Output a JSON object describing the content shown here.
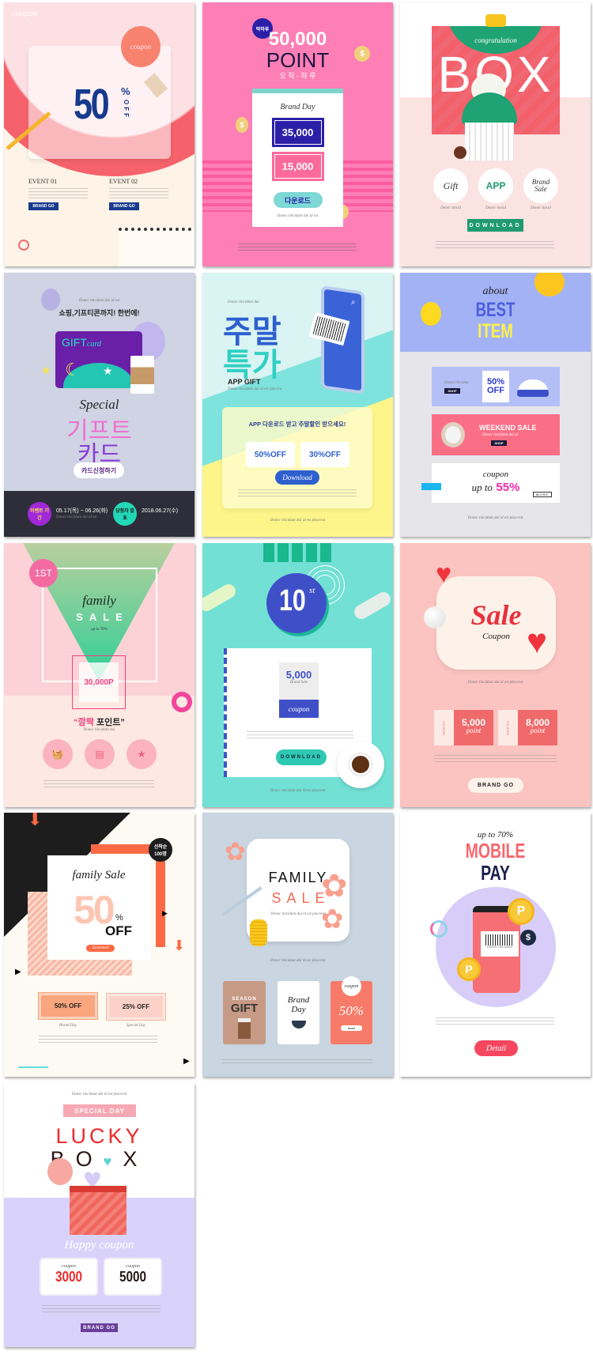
{
  "cards": [
    {
      "corner": "coupon",
      "balloon": "coupon",
      "big": "50",
      "pct": "%",
      "off": "OFF",
      "events": [
        {
          "title": "EVENT 01",
          "button": "BRAND GO"
        },
        {
          "title": "EVENT 02",
          "button": "BRAND GO"
        }
      ],
      "colors": {
        "bg": "#fdf3e6",
        "accent": "#163a8d"
      }
    },
    {
      "badge": "딱하루",
      "amount": "50,000",
      "title": "POINT",
      "sub": "오 직 - 하 루",
      "panel_title": "Brand Day",
      "coupon1": "35,000",
      "coupon2": "15,000",
      "button": "다운로드",
      "caption": "Donec tincidunt dui id est",
      "colors": {
        "bg": "#fd7fb5"
      }
    },
    {
      "ribbon": "congratulation",
      "title": "BOX",
      "circles": [
        "Gift",
        "APP",
        "Brand Sale"
      ],
      "circle_caption": "Donec tincid",
      "button": "DOWNLOAD",
      "colors": {
        "accent": "#1f9a71"
      }
    },
    {
      "caption": "Donec tincidunt dui id est",
      "headline": "쇼핑,기프티콘까지! 한번에!",
      "card_label": "GIFT",
      "card_label2": "card",
      "special": "Special",
      "title1": "기프트",
      "title2": "카드",
      "button": "카드신청하기",
      "badge1": "이벤트 기간",
      "date1": "05.17(목) ~ 06.26(화)",
      "badge2": "당첨자 발표",
      "date2": "2018.06.27(수)",
      "date_caption": "Donec tincidunt dui id est"
    },
    {
      "caption": "Donec tincidunt dui",
      "title1": "주말",
      "title2": "특가",
      "app": "APP GIFT",
      "app_caption": "Donec tincidunt dui id est placera",
      "panel_title": "APP 다운로드 받고 주말할인 받으세요!",
      "ticket1": "50%OFF",
      "ticket2": "30%OFF",
      "button": "Download",
      "footer": "Donec tincidunt dui id est placerat"
    },
    {
      "about": "about",
      "title1": "BEST",
      "title2": "ITEM",
      "banner1_caption": "Donec tincidun",
      "banner1_button": "SHOP",
      "note": "50% OFF",
      "banner2_title": "WEEKEND SALE",
      "banner2_caption": "Donec tincidunt dui id",
      "banner2_button": "SHOP",
      "coupon": "coupon",
      "upto": "up to",
      "pct": "55%",
      "more": "MORE",
      "footer": "Donec tincidunt dui id est placerat"
    },
    {
      "badge": "1ST",
      "family": "family",
      "sale": "SALE",
      "upto": "up to 70%",
      "points": "30,000P",
      "title_a": "“깜짝",
      "title_b": " 포인트”",
      "caption": "Donec tincidunt dui"
    },
    {
      "number": "10",
      "suffix": "st",
      "amount": "5,000",
      "amount_caption": "Brand Sale",
      "coupon": "coupon",
      "button": "DOWNLOAD",
      "footer": "Donec tincidunt dui id est placerat"
    },
    {
      "title": "Sale",
      "sub": "Coupon",
      "caption": "Donec tincidunt dui id est placerat",
      "coupons": [
        {
          "side": "COUPON",
          "value": "5,000",
          "unit": "point"
        },
        {
          "side": "COUPON",
          "value": "8,000",
          "unit": "point"
        }
      ],
      "button": "BRAND GO"
    },
    {
      "badge": "선착순 100명",
      "title": "family Sale",
      "big": "50",
      "pct": "%",
      "off": "OFF",
      "button": "Download",
      "box1": "50% OFF",
      "box1_caption": "Brand Day",
      "box2": "25% OFF",
      "box2_caption": "Special Day"
    },
    {
      "title1": "FAMILY",
      "title2": "SALE",
      "caption": "Donec tincidunt dui id est placerat",
      "tag1_small": "SEASON",
      "tag1_big": "GIFT",
      "tag2": "Brand Day",
      "tag3_label": "coupon",
      "tag3_value": "50%",
      "tag3_button": "more"
    },
    {
      "upto": "up to 70%",
      "title1": "MOBILE",
      "title2": "PAY",
      "barcode_caption": "Donec tincidunt",
      "coin": "P",
      "dollar": "$",
      "button": "Detail"
    },
    {
      "caption": "Donec tincidunt dui id est placerat",
      "ribbon": "SPECIAL DAY",
      "title1": "LUCKY",
      "title2a": "B",
      "title2b": "O",
      "title2c": "X",
      "happy": "Happy coupon",
      "coupons": [
        {
          "label": "coupon",
          "value": "3000"
        },
        {
          "label": "coupon",
          "value": "5000"
        }
      ],
      "button": "BRAND GO"
    }
  ]
}
